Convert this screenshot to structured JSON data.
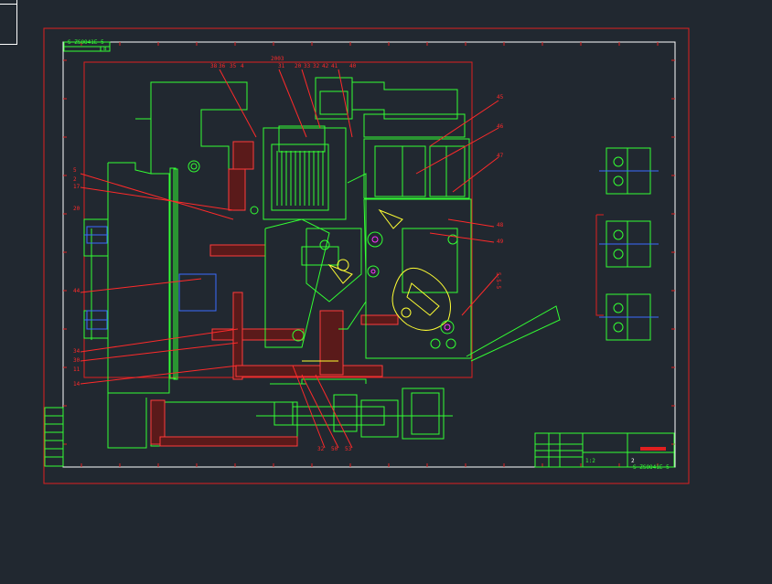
{
  "drawing": {
    "colors": {
      "background": "#212830",
      "outer_frame": "#e01f1f",
      "sheet": "#ffffff",
      "geometry": "#33ff33",
      "leaders": "#ff2a2a",
      "hatch": "#ff3b3b",
      "accent_yellow": "#ffff33",
      "accent_blue": "#3b6bff",
      "accent_cyan": "#33ffff"
    },
    "header_code": "S-ZSOO41E-5",
    "header_sub": "8",
    "top_label": "2003",
    "callouts_top": [
      "38",
      "36",
      "35",
      "4",
      "31",
      "20",
      "33",
      "32",
      "42",
      "41",
      "40"
    ],
    "callouts_right": [
      "45",
      "46",
      "47",
      "48",
      "49"
    ],
    "callouts_left": [
      "5",
      "2",
      "17",
      "20",
      "44",
      "34",
      "30",
      "11",
      "14"
    ],
    "side_note": "5-5-5",
    "bottom_callouts": [
      "32",
      "50",
      "53"
    ],
    "title_block": {
      "part_no": "S-ZSOO41E-5",
      "scale_label": "2",
      "sheet_mark": "1:2"
    }
  }
}
